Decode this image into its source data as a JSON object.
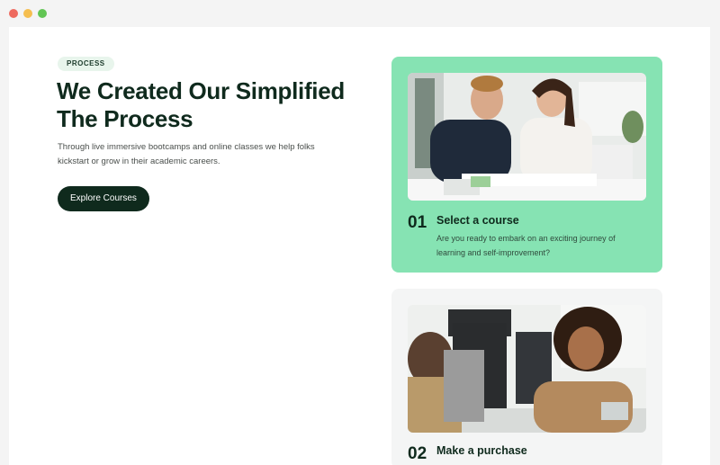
{
  "window": {
    "controls": [
      "close",
      "minimize",
      "maximize"
    ]
  },
  "hero": {
    "tag": "PROCESS",
    "headline": "We Created Our Simplified The Process",
    "subtext": "Through live immersive bootcamps and online classes we help folks kickstart or grow in their academic careers.",
    "cta_label": "Explore Courses"
  },
  "steps": [
    {
      "number": "01",
      "title": "Select a course",
      "description": "Are you ready to embark on an exciting journey of learning and self-improvement?",
      "image": "two-students-studying-photo"
    },
    {
      "number": "02",
      "title": "Make a purchase",
      "image": "smiling-woman-meeting-photo"
    }
  ],
  "colors": {
    "accent_green": "#86e3b3",
    "dark_green": "#0f2a1d",
    "tag_bg": "#e8f5ec"
  }
}
